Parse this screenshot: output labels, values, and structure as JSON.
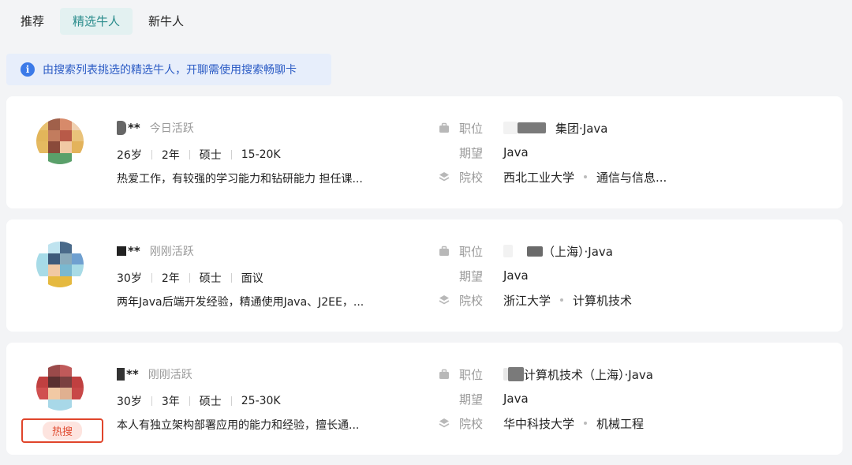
{
  "tabs": [
    {
      "label": "推荐"
    },
    {
      "label": "精选牛人"
    },
    {
      "label": "新牛人"
    }
  ],
  "notice": {
    "text": "由搜索列表挑选的精选牛人，开聊需使用搜索畅聊卡"
  },
  "labels": {
    "position": "职位",
    "expect": "期望",
    "school": "院校"
  },
  "candidates": [
    {
      "name": "**",
      "active": "今日活跃",
      "age": "26岁",
      "years": "2年",
      "degree": "硕士",
      "salary": "15-20K",
      "desc": "热爱工作，有较强的学习能力和钻研能力 担任课...",
      "position": "集团·Java",
      "expect": "Java",
      "school": "西北工业大学",
      "major": "通信与信息..."
    },
    {
      "name": "**",
      "active": "刚刚活跃",
      "age": "30岁",
      "years": "2年",
      "degree": "硕士",
      "salary": "面议",
      "desc": "两年Java后端开发经验，精通使用Java、J2EE，...",
      "position": "（上海）·Java",
      "expect": "Java",
      "school": "浙江大学",
      "major": "计算机技术"
    },
    {
      "name": "**",
      "active": "刚刚活跃",
      "age": "30岁",
      "years": "3年",
      "degree": "硕士",
      "salary": "25-30K",
      "desc": "本人有独立架构部署应用的能力和经验，擅长通...",
      "position": "计算机技术（上海）·Java",
      "expect": "Java",
      "school": "华中科技大学",
      "major": "机械工程",
      "badge": "热搜"
    }
  ]
}
